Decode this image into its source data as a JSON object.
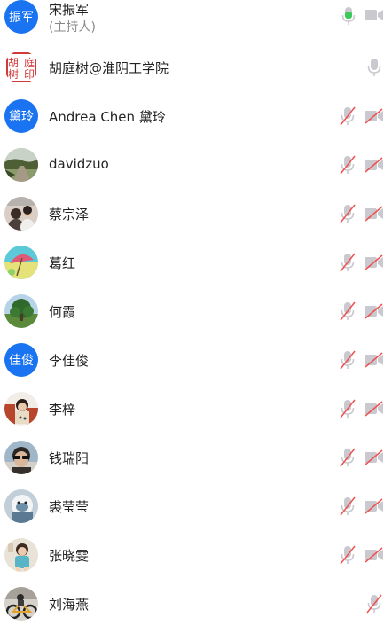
{
  "participants": [
    {
      "name": "宋振军",
      "sub": "(主持人)",
      "avatar_text": "振军",
      "avatar_type": "text",
      "mic": "speaking",
      "cam": "off-plain"
    },
    {
      "name": "胡庭树@淮阴工学院",
      "avatar_type": "seal",
      "mic": "on",
      "cam": "none"
    },
    {
      "name": "Andrea Chen 黛玲",
      "avatar_text": "黛玲",
      "avatar_type": "text",
      "mic": "muted",
      "cam": "muted"
    },
    {
      "name": "davidzuo",
      "avatar_type": "photo-road",
      "mic": "muted",
      "cam": "muted"
    },
    {
      "name": "蔡宗泽",
      "avatar_type": "photo-people",
      "mic": "muted",
      "cam": "muted"
    },
    {
      "name": "葛红",
      "avatar_type": "photo-umbrella",
      "mic": "muted",
      "cam": "muted"
    },
    {
      "name": "何霞",
      "avatar_type": "photo-tree",
      "mic": "muted",
      "cam": "muted"
    },
    {
      "name": "李佳俊",
      "avatar_text": "佳俊",
      "avatar_type": "text",
      "mic": "muted",
      "cam": "muted"
    },
    {
      "name": "李梓",
      "avatar_type": "photo-girl",
      "mic": "muted",
      "cam": "muted"
    },
    {
      "name": "钱瑞阳",
      "avatar_type": "photo-sunglasses",
      "mic": "muted",
      "cam": "muted"
    },
    {
      "name": "裘莹莹",
      "avatar_type": "photo-toy",
      "mic": "muted",
      "cam": "muted"
    },
    {
      "name": "张晓雯",
      "avatar_type": "photo-child",
      "mic": "muted",
      "cam": "muted"
    },
    {
      "name": "刘海燕",
      "avatar_type": "photo-bike",
      "mic": "muted",
      "cam": "none"
    }
  ],
  "seal_text": "胡庭树印",
  "colors": {
    "avatar_blue": "#1a73f0",
    "mic_speaking": "#3cc85a",
    "icon_gray": "#c9c9cf",
    "mute_red": "#f0504f"
  }
}
